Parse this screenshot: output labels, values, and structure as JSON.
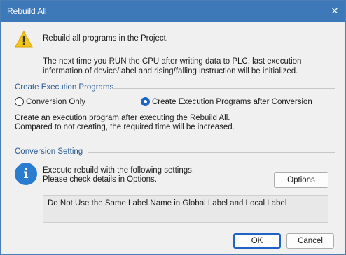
{
  "window": {
    "title": "Rebuild All",
    "close_glyph": "✕"
  },
  "message": {
    "icon": "warning-icon",
    "main": "Rebuild all programs in the Project.",
    "note": "The next time you RUN the CPU after writing data to PLC, last execution information of device/label and rising/falling instruction will be initialized."
  },
  "exec_programs": {
    "section_title": "Create Execution Programs",
    "options": [
      {
        "label": "Conversion Only",
        "selected": false
      },
      {
        "label": "Create Execution Programs after Conversion",
        "selected": true
      }
    ],
    "description_line1": "Create an execution program after executing the Rebuild All.",
    "description_line2": "Compared to not creating, the required time will be increased."
  },
  "conversion": {
    "section_title": "Conversion Setting",
    "icon": "info-icon",
    "info_glyph": "i",
    "line1": "Execute rebuild with the following settings.",
    "line2": "Please check details in Options.",
    "options_button": "Options",
    "setting_text": "Do Not Use the Same Label Name in Global Label and Local Label"
  },
  "buttons": {
    "ok": "OK",
    "cancel": "Cancel"
  },
  "colors": {
    "titlebar": "#3d78b8",
    "section_title": "#2a5b94",
    "accent": "#1f63c7",
    "warning": "#f5c518"
  }
}
